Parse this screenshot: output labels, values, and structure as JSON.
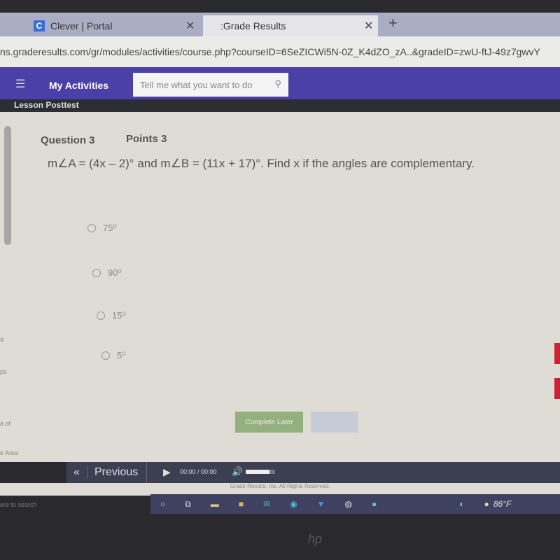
{
  "browser": {
    "tabs": [
      {
        "label": "Clever | Portal",
        "icon": "C"
      },
      {
        "label": ":Grade Results"
      }
    ],
    "url": "ns.graderesults.com/gr/modules/activities/course.php?courseID=6SeZICWi5N-0Z_K4dZO_zA..&gradeID=zwU-ftJ-49z7gwvY"
  },
  "nav": {
    "my_activities": "My Activities",
    "search_placeholder": "Tell me what you want to do"
  },
  "lesson_title": "Lesson Posttest",
  "question": {
    "number": "Question 3",
    "points": "Points 3",
    "text": "m∠A = (4x – 2)° and m∠B = (11x + 17)°. Find x if the angles are complementary.",
    "options": [
      "75⁰",
      "90⁰",
      "15⁰",
      "5⁰"
    ]
  },
  "buttons": {
    "complete_later": "Complete Later"
  },
  "side_labels": [
    "d",
    "ps",
    "a of",
    "e Area",
    "ere to search"
  ],
  "player": {
    "previous": "Previous",
    "time": "00:00 / 00:00",
    "volume": 0.8
  },
  "footer": "Grade Results, Inc. All Rights Reserved.",
  "taskbar": {
    "temperature": "86°F"
  }
}
